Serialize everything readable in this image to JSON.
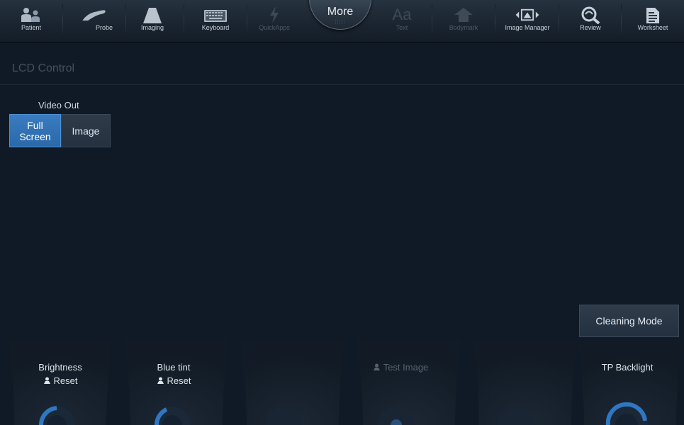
{
  "toolbar": {
    "items": [
      {
        "label": "Patient",
        "icon": "patient-icon",
        "enabled": true
      },
      {
        "label": "Probe",
        "icon": "probe-icon",
        "enabled": true
      },
      {
        "label": "Imaging",
        "icon": "imaging-icon",
        "enabled": true
      },
      {
        "label": "Keyboard",
        "icon": "keyboard-icon",
        "enabled": true
      },
      {
        "label": "QuickApps",
        "icon": "lightning-icon",
        "enabled": false
      },
      {
        "label": "Text",
        "icon": "text-icon",
        "enabled": false
      },
      {
        "label": "Bodymark",
        "icon": "bodymark-icon",
        "enabled": false
      },
      {
        "label": "Image Manager",
        "icon": "image-manager-icon",
        "enabled": true
      },
      {
        "label": "Review",
        "icon": "review-icon",
        "enabled": true
      },
      {
        "label": "Worksheet",
        "icon": "worksheet-icon",
        "enabled": true
      }
    ],
    "more_label": "More"
  },
  "page": {
    "title": "LCD Control"
  },
  "video_out": {
    "label": "Video Out",
    "options": [
      "Full Screen",
      "Image"
    ],
    "full_line1": "Full",
    "full_line2": "Screen",
    "image": "Image",
    "selected": "Full Screen"
  },
  "cleaning_mode": {
    "label": "Cleaning Mode"
  },
  "knobs": {
    "brightness": {
      "title": "Brightness",
      "reset": "Reset"
    },
    "blue_tint": {
      "title": "Blue tint",
      "reset": "Reset"
    },
    "test_image": {
      "title": "Test Image"
    },
    "tp_backlight": {
      "title": "TP Backlight"
    }
  },
  "colors": {
    "background": "#0f1a26",
    "accent": "#3a7cc0",
    "knob_ring": "#2f77c2"
  }
}
